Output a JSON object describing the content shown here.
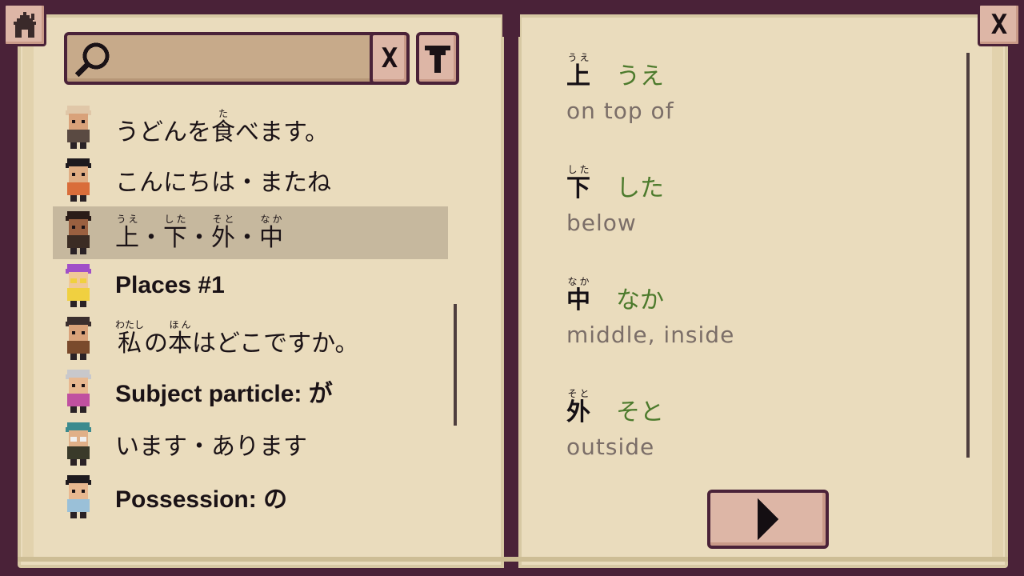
{
  "search": {
    "placeholder": "",
    "clear_label": "X"
  },
  "window": {
    "close_label": "X"
  },
  "lessons": [
    {
      "ruby": [
        {
          "base": "うどんを",
          "rt": ""
        },
        {
          "base": "食",
          "rt": "た"
        },
        {
          "base": "べます。",
          "rt": ""
        }
      ],
      "avatar": "bald-elder"
    },
    {
      "ruby": [
        {
          "base": "こんにちは・またね",
          "rt": ""
        }
      ],
      "avatar": "long-hair-girl"
    },
    {
      "ruby": [
        {
          "base": "上",
          "rt": "うえ"
        },
        {
          "base": "・",
          "rt": ""
        },
        {
          "base": "下",
          "rt": "した"
        },
        {
          "base": "・",
          "rt": ""
        },
        {
          "base": "外",
          "rt": "そと"
        },
        {
          "base": "・",
          "rt": ""
        },
        {
          "base": "中",
          "rt": "なか"
        }
      ],
      "avatar": "small-boy",
      "selected": true
    },
    {
      "title": "Places #1",
      "avatar": "purple-hair-girl"
    },
    {
      "ruby": [
        {
          "base": "私",
          "rt": "わたし"
        },
        {
          "base": "の",
          "rt": ""
        },
        {
          "base": "本",
          "rt": "ほん"
        },
        {
          "base": "はどこですか。",
          "rt": ""
        }
      ],
      "avatar": "hat-man"
    },
    {
      "title": "Subject particle: が",
      "avatar": "grey-hair-lady"
    },
    {
      "ruby": [
        {
          "base": "います・あります",
          "rt": ""
        }
      ],
      "avatar": "teal-hair-glasses"
    },
    {
      "title": "Possession: の",
      "avatar": "dark-hair-boy"
    }
  ],
  "vocab": [
    {
      "kanji": "上",
      "furigana": "うえ",
      "kana": "うえ",
      "meaning": "on top of"
    },
    {
      "kanji": "下",
      "furigana": "した",
      "kana": "した",
      "meaning": "below"
    },
    {
      "kanji": "中",
      "furigana": "なか",
      "kana": "なか",
      "meaning": "middle, inside"
    },
    {
      "kanji": "外",
      "furigana": "そと",
      "kana": "そと",
      "meaning": "outside"
    }
  ],
  "icons": {
    "home": "home-icon",
    "close": "close-icon",
    "search": "magnifier-icon",
    "clear": "clear-icon",
    "filter": "funnel-icon",
    "next": "play-arrow-icon"
  },
  "colors": {
    "frame": "#4a2238",
    "page": "#eadcbd",
    "selected_row": "#c6b89e",
    "kana": "#4c7a2c",
    "meaning": "#7b6e68",
    "button": "#ddb6a6"
  }
}
